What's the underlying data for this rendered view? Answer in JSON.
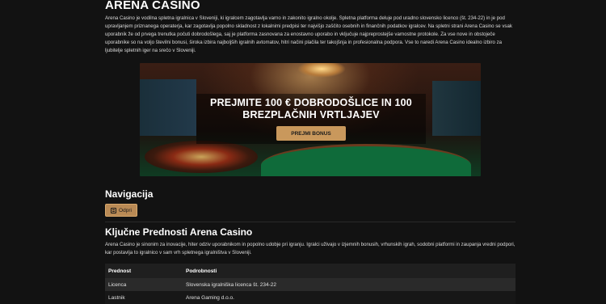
{
  "page": {
    "title": "ARENA CASINO",
    "intro": "Arena Casino je vodilna spletna igralnica v Sloveniji, ki igralcem zagotavlja varno in zakonito igralno okolje. Spletna platforma deluje pod uradno slovensko licenco (št. 234-22) in je pod upravljanjem priznanega operaterja, kar zagotavlja popolno skladnost z lokalnimi predpisi ter najvišjo zaščito osebnih in finančnih podatkov igralcev. Na spletni strani Arena Casino se vsak uporabnik že od prvega trenutka počuti dobrodošlega, saj je platforma zasnovana za enostavno uporabo in vključuje najpreprostejše varnostne protokole. Za vse nove in obstoječe uporabnike so na voljo številni bonusi, široka izbira najboljših igralnih avtomatov, hitri načini plačila ter takojšnja in profesionalna podpora. Vse to naredi Arena Casino idealno izbiro za ljubitelje spletnih iger na srečo v Sloveniji."
  },
  "hero": {
    "headline": "PREJMITE 100 € DOBRODOŠLICE IN 100 BREZPLAČNIH VRTLJAJEV",
    "button_label": "PREJMI BONUS"
  },
  "navigation": {
    "title": "Navigacija",
    "button_label": "Odpri",
    "button_icon": "menu-icon"
  },
  "advantages": {
    "title": "Ključne Prednosti Arena Casino",
    "text": "Arena Casino je sinonim za inovacije, hiter odziv uporabnikom in popolno udobje pri igranju. Igralci uživajo v izjemnih bonusih, vrhunskih igrah, sodobni platformi in zaupanja vredni podpori, kar postavlja to igralnico v sam vrh spletnega igralništva v Sloveniji.",
    "table": {
      "headers": [
        "Prednost",
        "Podrobnosti"
      ],
      "rows": [
        [
          "Licenca",
          "Slovenska igralniška licenca št. 234-22"
        ],
        [
          "Lastnik",
          "Arena Gaming d.o.o."
        ]
      ]
    }
  },
  "colors": {
    "background": "#121212",
    "accent": "#c9985c",
    "text": "#e6e6e6"
  }
}
